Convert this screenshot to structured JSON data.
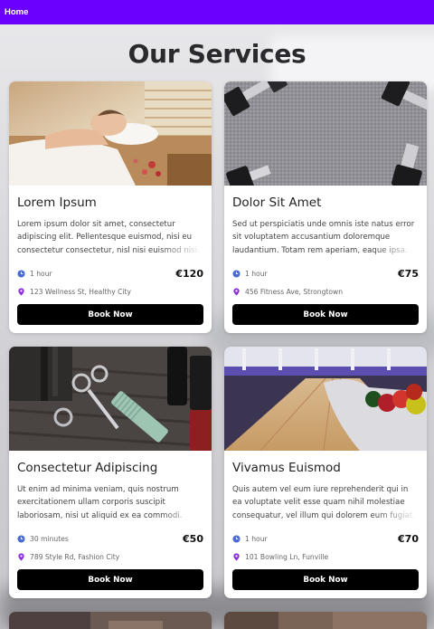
{
  "nav": {
    "home_label": "Home"
  },
  "page": {
    "title": "Our Services"
  },
  "services": [
    {
      "title": "Lorem Ipsum",
      "description": "Lorem ipsum dolor sit amet, consectetur adipiscing elit. Pellentesque euismod, nisi eu consectetur consectetur, nisl nisi euismod nisi.",
      "duration": "1 hour",
      "price": "€120",
      "location": "123 Wellness St, Healthy City",
      "button": "Book Now",
      "image": "spa-massage"
    },
    {
      "title": "Dolor Sit Amet",
      "description": "Sed ut perspiciatis unde omnis iste natus error sit voluptatem accusantium doloremque laudantium. Totam rem aperiam, eaque ipsa.",
      "duration": "1 hour",
      "price": "€75",
      "location": "456 Fitness Ave, Strongtown",
      "button": "Book Now",
      "image": "dumbbells"
    },
    {
      "title": "Consectetur Adipiscing",
      "description": "Ut enim ad minima veniam, quis nostrum exercitationem ullam corporis suscipit laboriosam, nisi ut aliquid ex ea commodi.",
      "duration": "30 minutes",
      "price": "€50",
      "location": "789 Style Rd, Fashion City",
      "button": "Book Now",
      "image": "barber-tools"
    },
    {
      "title": "Vivamus Euismod",
      "description": "Quis autem vel eum iure reprehenderit qui in ea voluptate velit esse quam nihil molestiae consequatur, vel illum qui dolorem eum fugiat.",
      "duration": "1 hour",
      "price": "€70",
      "location": "101 Bowling Ln, Funville",
      "button": "Book Now",
      "image": "bowling-alley"
    }
  ],
  "colors": {
    "nav": "#6c00ff",
    "button": "#000000",
    "icon_clock": "#4a6ad6",
    "icon_pin": "#8a2be2"
  }
}
